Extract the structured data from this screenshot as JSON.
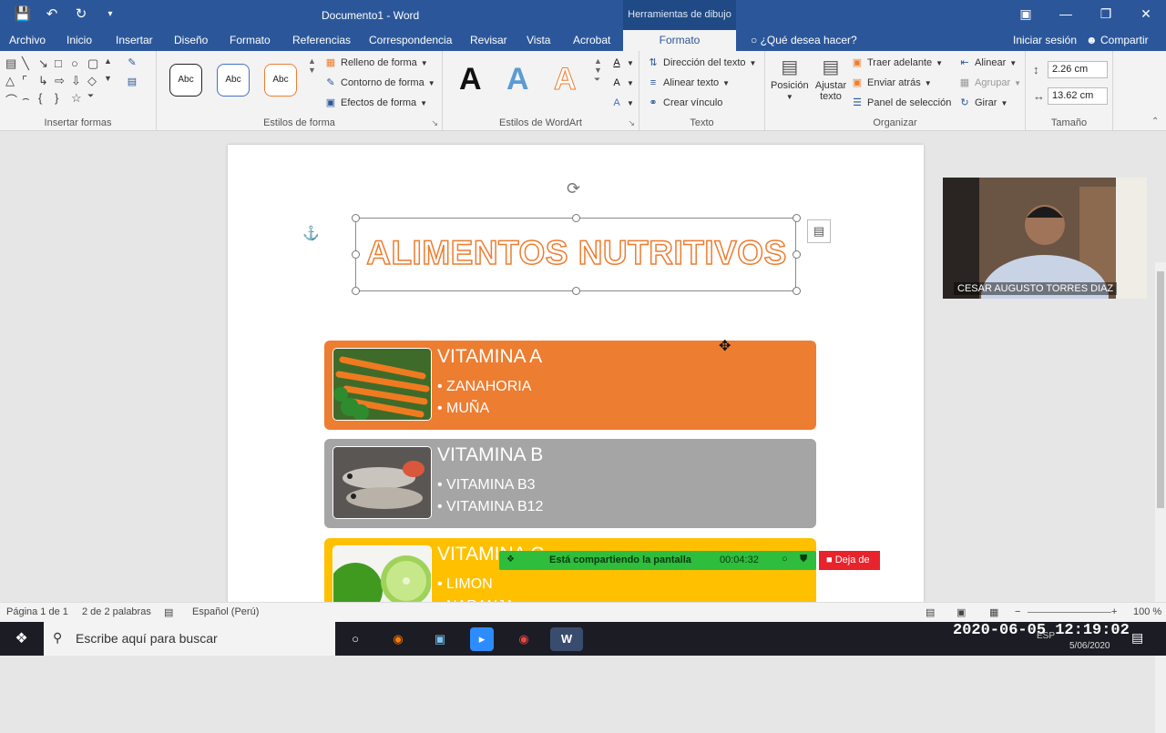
{
  "titlebar": {
    "doc_title": "Documento1 - Word",
    "context_tab": "Herramientas de dibujo",
    "qat_icons": [
      "save-icon",
      "undo-icon",
      "redo-icon",
      "customize-icon"
    ],
    "window_controls": [
      "ribbon-display-icon",
      "minimize-icon",
      "restore-icon",
      "close-icon"
    ]
  },
  "tabs": [
    {
      "label": "Archivo"
    },
    {
      "label": "Inicio"
    },
    {
      "label": "Insertar"
    },
    {
      "label": "Diseño"
    },
    {
      "label": "Formato"
    },
    {
      "label": "Referencias"
    },
    {
      "label": "Correspondencia"
    },
    {
      "label": "Revisar"
    },
    {
      "label": "Vista"
    },
    {
      "label": "Acrobat"
    },
    {
      "label": "Formato",
      "active": true
    }
  ],
  "tell_me": "¿Qué desea hacer?",
  "signin": "Iniciar sesión",
  "share": "Compartir",
  "ribbon": {
    "insert_shapes_label": "Insertar formas",
    "shape_styles_label": "Estilos de forma",
    "style_sample": "Abc",
    "fill": "Relleno de forma",
    "outline": "Contorno de forma",
    "effects": "Efectos de forma",
    "wordart_label": "Estilos de WordArt",
    "wordart_letter": "A",
    "text_direction": "Dirección del texto",
    "align_text": "Alinear texto",
    "create_link": "Crear vínculo",
    "text_label": "Texto",
    "position": "Posición",
    "wrap_text": "Ajustar texto",
    "bring_forward": "Traer adelante",
    "send_backward": "Enviar atrás",
    "selection_pane": "Panel de selección",
    "align": "Alinear",
    "group": "Agrupar",
    "rotate": "Girar",
    "arrange_label": "Organizar",
    "height": "2.26 cm",
    "width": "13.62 cm",
    "size_label": "Tamaño"
  },
  "document": {
    "wordart_title": "ALIMENTOS NUTRITIVOS",
    "cards": [
      {
        "title": "VITAMINA A",
        "items": [
          "• ZANAHORIA",
          "• MUÑA"
        ],
        "color": "#ed7d31"
      },
      {
        "title": "VITAMINA B",
        "items": [
          "• VITAMINA B3",
          "• VITAMINA B12"
        ],
        "color": "#a5a5a5"
      },
      {
        "title": "VITAMINA C",
        "items": [
          "• LIMON",
          "• NARANJA"
        ],
        "color": "#ffc000"
      }
    ]
  },
  "webcam": {
    "name": "CESAR AUGUSTO TORRES DIAZ"
  },
  "sharing": {
    "text": "Está compartiendo la pantalla",
    "time": "00:04:32",
    "stop": "Deja de"
  },
  "status": {
    "page": "Página 1 de 1",
    "words": "2 de 2 palabras",
    "language": "Español (Perú)",
    "zoom": "100 %"
  },
  "taskbar": {
    "search_placeholder": "Escribe aquí para buscar",
    "datetime": "2020-06-05 12:19:02",
    "date": "5/06/2020",
    "lang": "ESP"
  }
}
